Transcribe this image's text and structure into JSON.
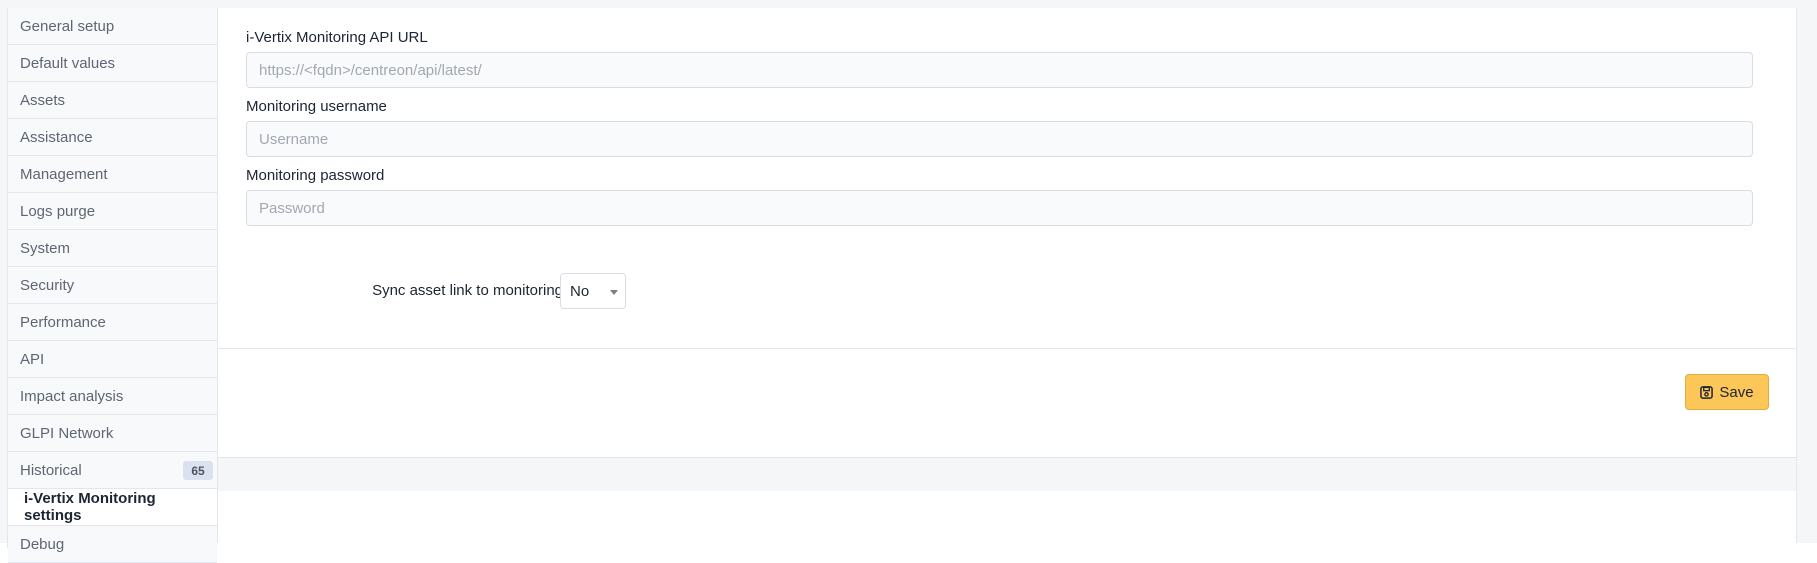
{
  "sidebar": {
    "items": [
      {
        "label": "General setup"
      },
      {
        "label": "Default values"
      },
      {
        "label": "Assets"
      },
      {
        "label": "Assistance"
      },
      {
        "label": "Management"
      },
      {
        "label": "Logs purge"
      },
      {
        "label": "System"
      },
      {
        "label": "Security"
      },
      {
        "label": "Performance"
      },
      {
        "label": "API"
      },
      {
        "label": "Impact analysis"
      },
      {
        "label": "GLPI Network"
      },
      {
        "label": "Historical",
        "badge": "65"
      },
      {
        "label": "i-Vertix Monitoring settings",
        "active": true
      },
      {
        "label": "Debug"
      }
    ]
  },
  "form": {
    "api_url": {
      "label": "i-Vertix Monitoring API URL",
      "placeholder": "https://<fqdn>/centreon/api/latest/",
      "value": ""
    },
    "username": {
      "label": "Monitoring username",
      "placeholder": "Username",
      "value": ""
    },
    "password": {
      "label": "Monitoring password",
      "placeholder": "Password",
      "value": ""
    },
    "sync": {
      "label": "Sync asset link to monitoring",
      "selected": "No"
    }
  },
  "footer": {
    "save_label": "Save"
  },
  "colors": {
    "save_button": "#fcc758",
    "badge_bg": "#dbe1ef"
  }
}
